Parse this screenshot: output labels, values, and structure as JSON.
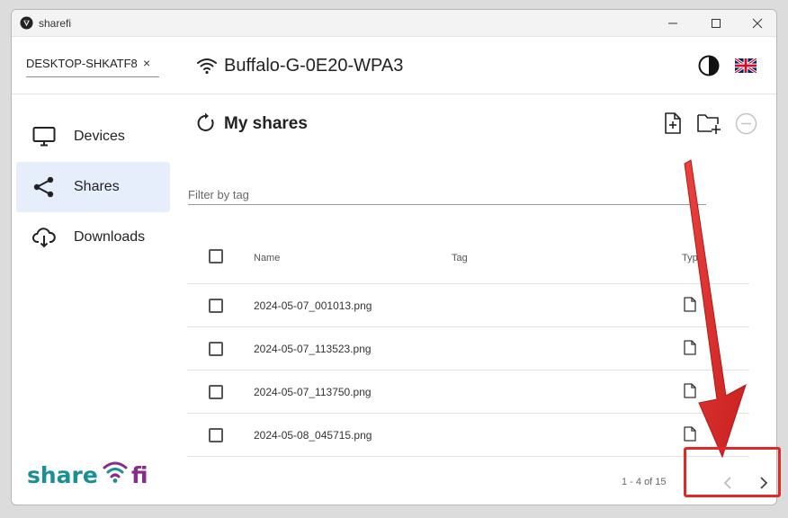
{
  "window": {
    "title": "sharefi"
  },
  "header": {
    "device_name": "DESKTOP-SHKATF8",
    "clear_symbol": "×",
    "network_name": "Buffalo-G-0E20-WPA3"
  },
  "sidebar": {
    "items": [
      {
        "label": "Devices",
        "icon": "monitor-icon",
        "active": false
      },
      {
        "label": "Shares",
        "icon": "share-icon",
        "active": true
      },
      {
        "label": "Downloads",
        "icon": "cloud-download-icon",
        "active": false
      }
    ],
    "logo_text": "sharefi"
  },
  "main": {
    "title": "My shares",
    "filter_placeholder": "Filter by tag",
    "columns": [
      "Name",
      "Tag",
      "Type"
    ],
    "rows": [
      {
        "name": "2024-05-07_001013.png",
        "tag": "",
        "type": "file-icon"
      },
      {
        "name": "2024-05-07_113523.png",
        "tag": "",
        "type": "file-icon"
      },
      {
        "name": "2024-05-07_113750.png",
        "tag": "",
        "type": "file-icon"
      },
      {
        "name": "2024-05-08_045715.png",
        "tag": "",
        "type": "file-icon"
      }
    ],
    "pagination": "1 - 4 of 15"
  },
  "colors": {
    "active_nav": "#e6eefc",
    "annotation_red": "#e02a2a",
    "logo_teal": "#1a8f96",
    "logo_purple": "#8a2a8a"
  }
}
